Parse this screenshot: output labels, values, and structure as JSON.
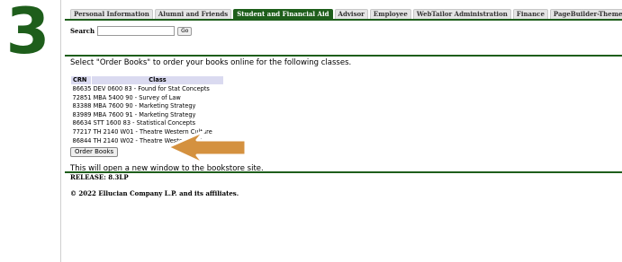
{
  "step": {
    "number": "3"
  },
  "tabs": [
    {
      "label": "Personal Information",
      "active": false
    },
    {
      "label": "Alumni and Friends",
      "active": false
    },
    {
      "label": "Student and Financial Aid",
      "active": true
    },
    {
      "label": "Advisor",
      "active": false
    },
    {
      "label": "Employee",
      "active": false
    },
    {
      "label": "WebTailor Administration",
      "active": false
    },
    {
      "label": "Finance",
      "active": false
    },
    {
      "label": "PageBuilder-ThemeEditor",
      "active": false
    }
  ],
  "search": {
    "label": "Search",
    "value": "",
    "go_label": "Go"
  },
  "instructions": "Select \"Order Books\" to order your books online for the following classes.",
  "table": {
    "headers": {
      "crn": "CRN",
      "class": "Class"
    },
    "rows": [
      "86635 DEV 0600 83 - Found for Stat Concepts",
      "72851 MBA 5400 90 - Survey of Law",
      "83388 MBA 7600 90 - Marketing Strategy",
      "83989 MBA 7600 91 - Marketing Strategy",
      "86634 STT 1600 83 - Statistical Concepts",
      "77217 TH 2140 W01 - Theatre Western Culture",
      "86844 TH 2140 W02 - Theatre Western Culture"
    ]
  },
  "order_button_label": "Order Books",
  "note": "This will open a new window to the bookstore site.",
  "release": "RELEASE: 8.3LP",
  "copyright": "© 2022 Ellucian Company L.P. and its affiliates.",
  "colors": {
    "brand_green": "#1e5e1b",
    "arrow": "#d4913f",
    "table_header": "#dadaf0"
  }
}
